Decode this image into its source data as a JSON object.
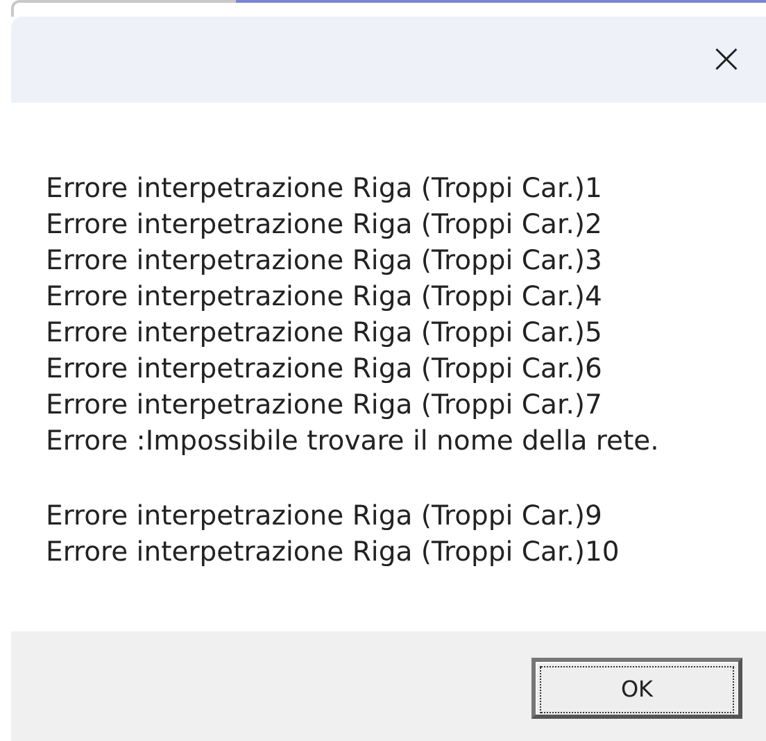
{
  "dialog": {
    "close": "×"
  },
  "message": {
    "paragraphs": [
      [
        "Errore interpetrazione Riga (Troppi Car.)1",
        "Errore interpetrazione Riga (Troppi Car.)2",
        "Errore interpetrazione Riga (Troppi Car.)3",
        "Errore interpetrazione Riga (Troppi Car.)4",
        "Errore interpetrazione Riga (Troppi Car.)5",
        "Errore interpetrazione Riga (Troppi Car.)6",
        "Errore interpetrazione Riga (Troppi Car.)7",
        "Errore :Impossibile trovare il nome della rete."
      ],
      [
        "Errore interpetrazione Riga (Troppi Car.)9",
        "Errore interpetrazione Riga (Troppi Car.)10"
      ]
    ]
  },
  "buttons": [
    "OK"
  ]
}
